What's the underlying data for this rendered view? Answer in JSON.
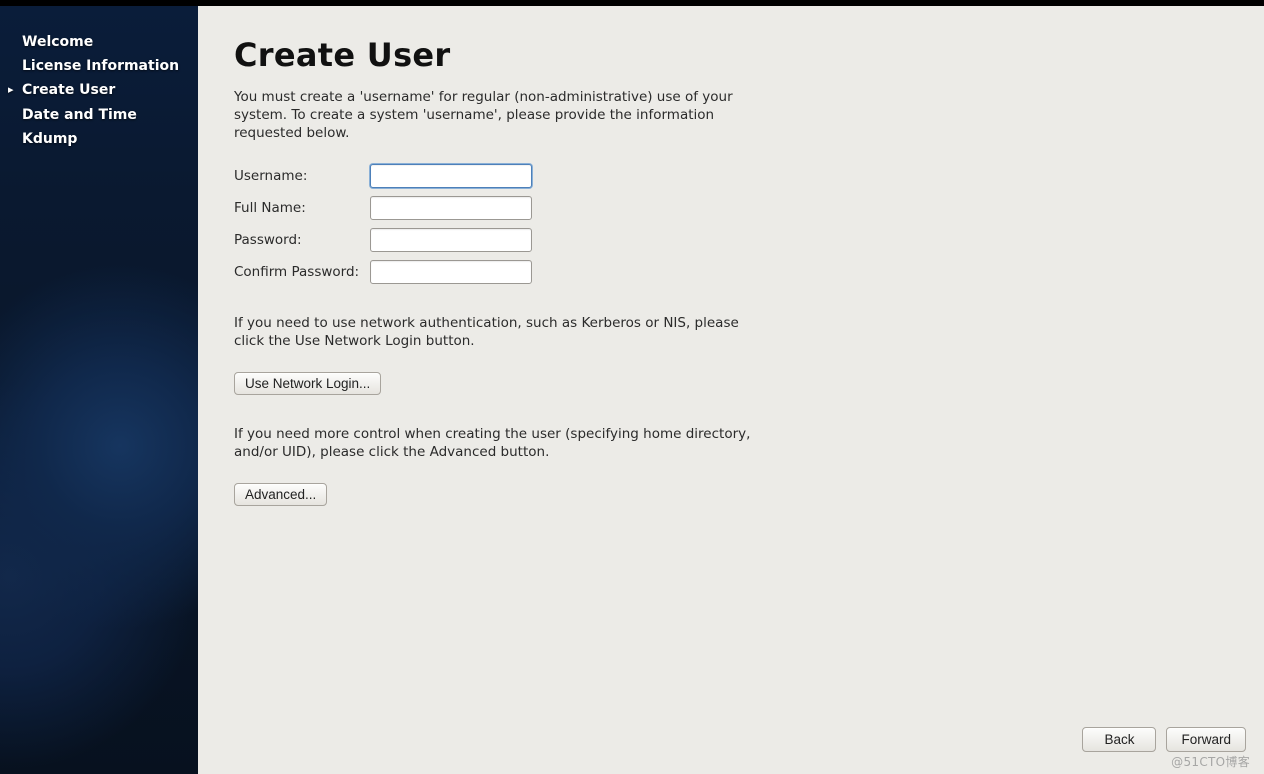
{
  "sidebar": {
    "items": [
      {
        "label": "Welcome",
        "active": false
      },
      {
        "label": "License Information",
        "active": false
      },
      {
        "label": "Create User",
        "active": true
      },
      {
        "label": "Date and Time",
        "active": false
      },
      {
        "label": "Kdump",
        "active": false
      }
    ]
  },
  "main": {
    "title": "Create User",
    "intro": "You must create a 'username' for regular (non-administrative) use of your system.  To create a system 'username', please provide the information requested below.",
    "fields": {
      "username_label": "Username:",
      "username_value": "",
      "fullname_label": "Full Name:",
      "fullname_value": "",
      "password_label": "Password:",
      "password_value": "",
      "confirm_label": "Confirm Password:",
      "confirm_value": ""
    },
    "network_hint": "If you need to use network authentication, such as Kerberos or NIS, please click the Use Network Login button.",
    "network_button": "Use Network Login...",
    "advanced_hint": "If you need more control when creating the user (specifying home directory, and/or UID), please click the Advanced button.",
    "advanced_button": "Advanced..."
  },
  "footer": {
    "back": "Back",
    "forward": "Forward"
  },
  "watermark": "@51CTO博客"
}
